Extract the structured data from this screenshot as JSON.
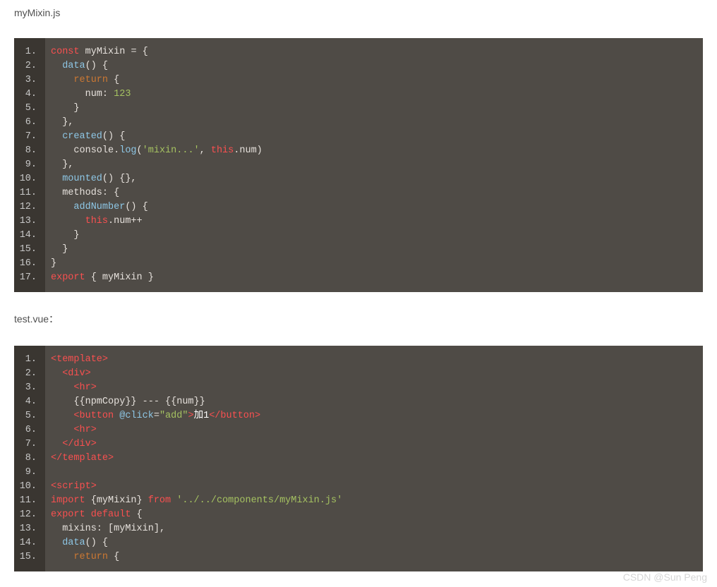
{
  "watermark": "CSDN @Sun  Peng",
  "file1": {
    "name": "myMixin.js",
    "lines": 17,
    "code": [
      [
        [
          "kw2",
          "const"
        ],
        [
          "punc",
          " "
        ],
        [
          "name",
          "myMixin"
        ],
        [
          "punc",
          " = {"
        ]
      ],
      [
        [
          "punc",
          "  "
        ],
        [
          "func",
          "data"
        ],
        [
          "punc",
          "() {"
        ]
      ],
      [
        [
          "punc",
          "    "
        ],
        [
          "kw1",
          "return"
        ],
        [
          "punc",
          " {"
        ]
      ],
      [
        [
          "punc",
          "      num: "
        ],
        [
          "num",
          "123"
        ]
      ],
      [
        [
          "punc",
          "    }"
        ]
      ],
      [
        [
          "punc",
          "  },"
        ]
      ],
      [
        [
          "punc",
          "  "
        ],
        [
          "func",
          "created"
        ],
        [
          "punc",
          "() {"
        ]
      ],
      [
        [
          "punc",
          "    console."
        ],
        [
          "func",
          "log"
        ],
        [
          "punc",
          "("
        ],
        [
          "str",
          "'mixin...'"
        ],
        [
          "punc",
          ", "
        ],
        [
          "kw2",
          "this"
        ],
        [
          "punc",
          ".num)"
        ]
      ],
      [
        [
          "punc",
          "  },"
        ]
      ],
      [
        [
          "punc",
          "  "
        ],
        [
          "func",
          "mounted"
        ],
        [
          "punc",
          "() {},"
        ]
      ],
      [
        [
          "punc",
          "  methods: {"
        ]
      ],
      [
        [
          "punc",
          "    "
        ],
        [
          "func",
          "addNumber"
        ],
        [
          "punc",
          "() {"
        ]
      ],
      [
        [
          "punc",
          "      "
        ],
        [
          "kw2",
          "this"
        ],
        [
          "punc",
          ".num++"
        ]
      ],
      [
        [
          "punc",
          "    }"
        ]
      ],
      [
        [
          "punc",
          "  }"
        ]
      ],
      [
        [
          "punc",
          "}"
        ]
      ],
      [
        [
          "kw2",
          "export"
        ],
        [
          "punc",
          " { myMixin }"
        ]
      ]
    ]
  },
  "file2": {
    "name": "test.vue：",
    "lines": 15,
    "code": [
      [
        [
          "tag",
          "<template>"
        ]
      ],
      [
        [
          "punc",
          "  "
        ],
        [
          "tag",
          "<div>"
        ]
      ],
      [
        [
          "punc",
          "    "
        ],
        [
          "tag",
          "<hr>"
        ]
      ],
      [
        [
          "punc",
          "    {{npmCopy}} --- {{num}}"
        ]
      ],
      [
        [
          "punc",
          "    "
        ],
        [
          "tag",
          "<button"
        ],
        [
          "punc",
          " "
        ],
        [
          "func",
          "@click"
        ],
        [
          "punc",
          "="
        ],
        [
          "str",
          "\"add\""
        ],
        [
          "tag",
          ">"
        ],
        [
          "white",
          "加1"
        ],
        [
          "tag",
          "</button>"
        ]
      ],
      [
        [
          "punc",
          "    "
        ],
        [
          "tag",
          "<hr>"
        ]
      ],
      [
        [
          "punc",
          "  "
        ],
        [
          "tag",
          "</div>"
        ]
      ],
      [
        [
          "tag",
          "</template>"
        ]
      ],
      [
        [
          "punc",
          " "
        ]
      ],
      [
        [
          "tag",
          "<script>"
        ]
      ],
      [
        [
          "kw2",
          "import"
        ],
        [
          "punc",
          " {"
        ],
        [
          "name",
          "myMixin"
        ],
        [
          "punc",
          "} "
        ],
        [
          "kw2",
          "from"
        ],
        [
          "punc",
          " "
        ],
        [
          "str",
          "'../../components/myMixin.js'"
        ]
      ],
      [
        [
          "kw2",
          "export"
        ],
        [
          "punc",
          " "
        ],
        [
          "kw2",
          "default"
        ],
        [
          "punc",
          " {"
        ]
      ],
      [
        [
          "punc",
          "  mixins: ["
        ],
        [
          "name",
          "myMixin"
        ],
        [
          "punc",
          "],"
        ]
      ],
      [
        [
          "punc",
          "  "
        ],
        [
          "func",
          "data"
        ],
        [
          "punc",
          "() {"
        ]
      ],
      [
        [
          "punc",
          "    "
        ],
        [
          "kw1",
          "return"
        ],
        [
          "punc",
          " {"
        ]
      ]
    ]
  }
}
